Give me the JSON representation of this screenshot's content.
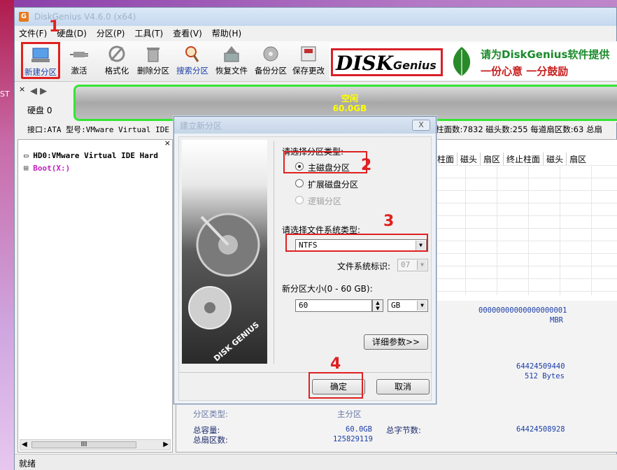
{
  "desktop": {
    "left_text": "ST"
  },
  "app": {
    "title": "DiskGenius V4.6.0 (x64)",
    "logo": "G"
  },
  "menu": [
    "文件(F)",
    "硬盘(D)",
    "分区(P)",
    "工具(T)",
    "查看(V)",
    "帮助(H)"
  ],
  "toolbar": {
    "new_partition": "新建分区",
    "activate": "激活",
    "format": "格式化",
    "delete_partition": "删除分区",
    "search_partition": "搜索分区",
    "recover_files": "恢复文件",
    "backup_partition": "备份分区",
    "save_changes": "保存更改"
  },
  "banner": {
    "dk": "DISK",
    "genius": "Genius",
    "line1": "请为DiskGenius软件提供",
    "line2": "一份心意 一分鼓励"
  },
  "disk": {
    "label": "硬盘 0",
    "space_label": "空闲",
    "space_size": "60.0GB",
    "info_left": "接口:ATA  型号:VMware Virtual IDE Hard Drive",
    "info_right": "柱面数:7832   磁头数:255   每道扇区数:63   总扇"
  },
  "tree": {
    "disk": "HD0:VMware Virtual IDE Hard",
    "boot": "Boot(X:)",
    "scroll_glyph": "III"
  },
  "grid_headers": [
    "柱面",
    "磁头",
    "扇区",
    "终止柱面",
    "磁头",
    "扇区"
  ],
  "lower": {
    "guid": "00000000000000000001",
    "mbr": "MBR",
    "bytes_total": "64424509440",
    "sector_size": "512 Bytes",
    "capacity_label": "总容量:",
    "capacity_value": "60.0GB",
    "total_bytes_label": "总字节数:",
    "total_bytes_value": "64424508928",
    "sectors_label": "总扇区数:",
    "sectors_value": "125829119",
    "partial_label": "分区类型:",
    "partial_value": "主分区"
  },
  "status": "就绪",
  "steps": [
    "1",
    "2",
    "3",
    "4"
  ],
  "dialog": {
    "title": "建立新分区",
    "close": "X",
    "partition_type_label": "请选择分区类型:",
    "primary": "主磁盘分区",
    "extended": "扩展磁盘分区",
    "logical": "逻辑分区",
    "fs_label": "请选择文件系统类型:",
    "fs_value": "NTFS",
    "fs_id_label": "文件系统标识:",
    "fs_id_value": "07",
    "size_label": "新分区大小(0 - 60 GB):",
    "size_value": "60",
    "unit": "GB",
    "details": "详细参数>>",
    "ok": "确定",
    "cancel": "取消",
    "hdd_text": "DISK GENIUS"
  }
}
